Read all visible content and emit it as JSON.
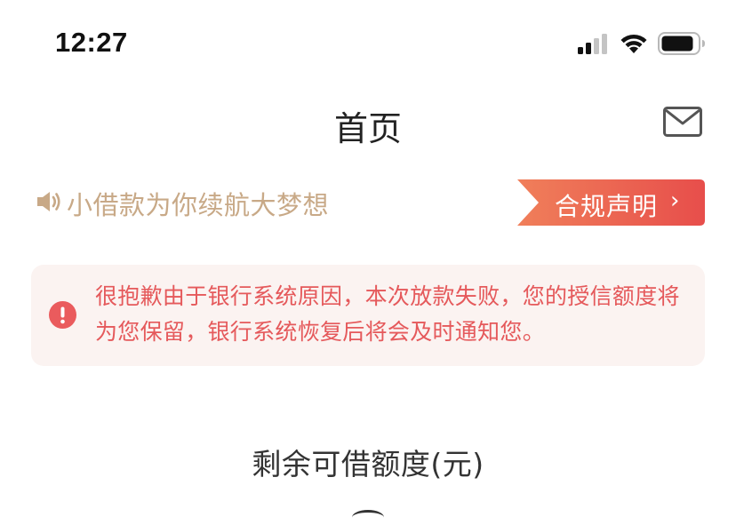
{
  "status_bar": {
    "time": "12:27",
    "icons": [
      "signal-icon",
      "wifi-icon",
      "battery-icon"
    ]
  },
  "nav": {
    "title": "首页",
    "mail_icon": "mail-icon"
  },
  "notice": {
    "icon": "speaker-icon",
    "text": "小借款为你续航大梦想",
    "compliance_label": "合规声明",
    "compliance_chevron": "›"
  },
  "error_card": {
    "icon": "alert-icon",
    "message": "很抱歉由于银行系统原因，本次放款失败，您的授信额度将为您保留，银行系统恢复后将会及时通知您。"
  },
  "credit": {
    "label": "剩余可借额度(元)"
  },
  "colors": {
    "notice_text": "#c8a987",
    "compliance_gradient_start": "#f07f5a",
    "compliance_gradient_end": "#e74e4b",
    "error_text": "#e5595b",
    "error_bg": "#fbf3f1",
    "alert_icon": "#ea5b5d"
  }
}
